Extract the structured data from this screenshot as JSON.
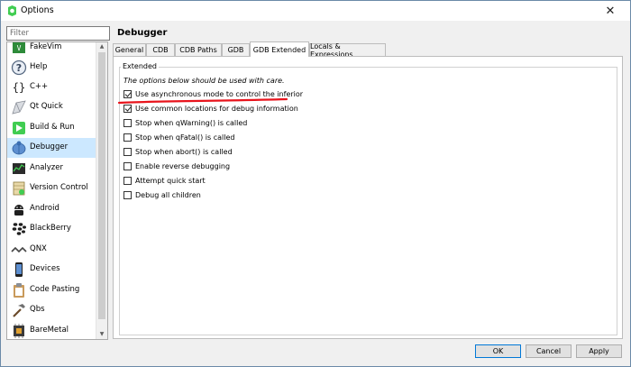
{
  "window": {
    "title": "Options",
    "close_glyph": "✕"
  },
  "filter": {
    "placeholder": "Filter",
    "value": ""
  },
  "sidebar": {
    "items": [
      {
        "label": "FakeVim",
        "icon": "fakevim-icon",
        "selected": false
      },
      {
        "label": "Help",
        "icon": "help-icon",
        "selected": false
      },
      {
        "label": "C++",
        "icon": "cpp-icon",
        "selected": false
      },
      {
        "label": "Qt Quick",
        "icon": "qt-quick-icon",
        "selected": false
      },
      {
        "label": "Build & Run",
        "icon": "build-run-icon",
        "selected": false
      },
      {
        "label": "Debugger",
        "icon": "debugger-icon",
        "selected": true
      },
      {
        "label": "Analyzer",
        "icon": "analyzer-icon",
        "selected": false
      },
      {
        "label": "Version Control",
        "icon": "version-control-icon",
        "selected": false
      },
      {
        "label": "Android",
        "icon": "android-icon",
        "selected": false
      },
      {
        "label": "BlackBerry",
        "icon": "blackberry-icon",
        "selected": false
      },
      {
        "label": "QNX",
        "icon": "qnx-icon",
        "selected": false
      },
      {
        "label": "Devices",
        "icon": "devices-icon",
        "selected": false
      },
      {
        "label": "Code Pasting",
        "icon": "code-pasting-icon",
        "selected": false
      },
      {
        "label": "Qbs",
        "icon": "qbs-icon",
        "selected": false
      },
      {
        "label": "BareMetal",
        "icon": "baremetal-icon",
        "selected": false
      }
    ]
  },
  "page": {
    "heading": "Debugger"
  },
  "tabs": [
    {
      "label": "General",
      "active": false
    },
    {
      "label": "CDB",
      "active": false
    },
    {
      "label": "CDB Paths",
      "active": false
    },
    {
      "label": "GDB",
      "active": false
    },
    {
      "label": "GDB Extended",
      "active": true
    },
    {
      "label": "Locals & Expressions",
      "active": false
    }
  ],
  "extended": {
    "group_title": "Extended",
    "note": "The options below should be used with care.",
    "options": [
      {
        "label": "Use asynchronous mode to control the inferior",
        "checked": true
      },
      {
        "label": "Use common locations for debug information",
        "checked": true
      },
      {
        "label": "Stop when qWarning() is called",
        "checked": false
      },
      {
        "label": "Stop when qFatal() is called",
        "checked": false
      },
      {
        "label": "Stop when abort() is called",
        "checked": false
      },
      {
        "label": "Enable reverse debugging",
        "checked": false
      },
      {
        "label": "Attempt quick start",
        "checked": false
      },
      {
        "label": "Debug all children",
        "checked": false
      }
    ]
  },
  "buttons": {
    "ok": "OK",
    "cancel": "Cancel",
    "apply": "Apply"
  },
  "colors": {
    "selection": "#cce8ff",
    "annotation": "#e8141c",
    "qt_green": "#41cd52"
  }
}
